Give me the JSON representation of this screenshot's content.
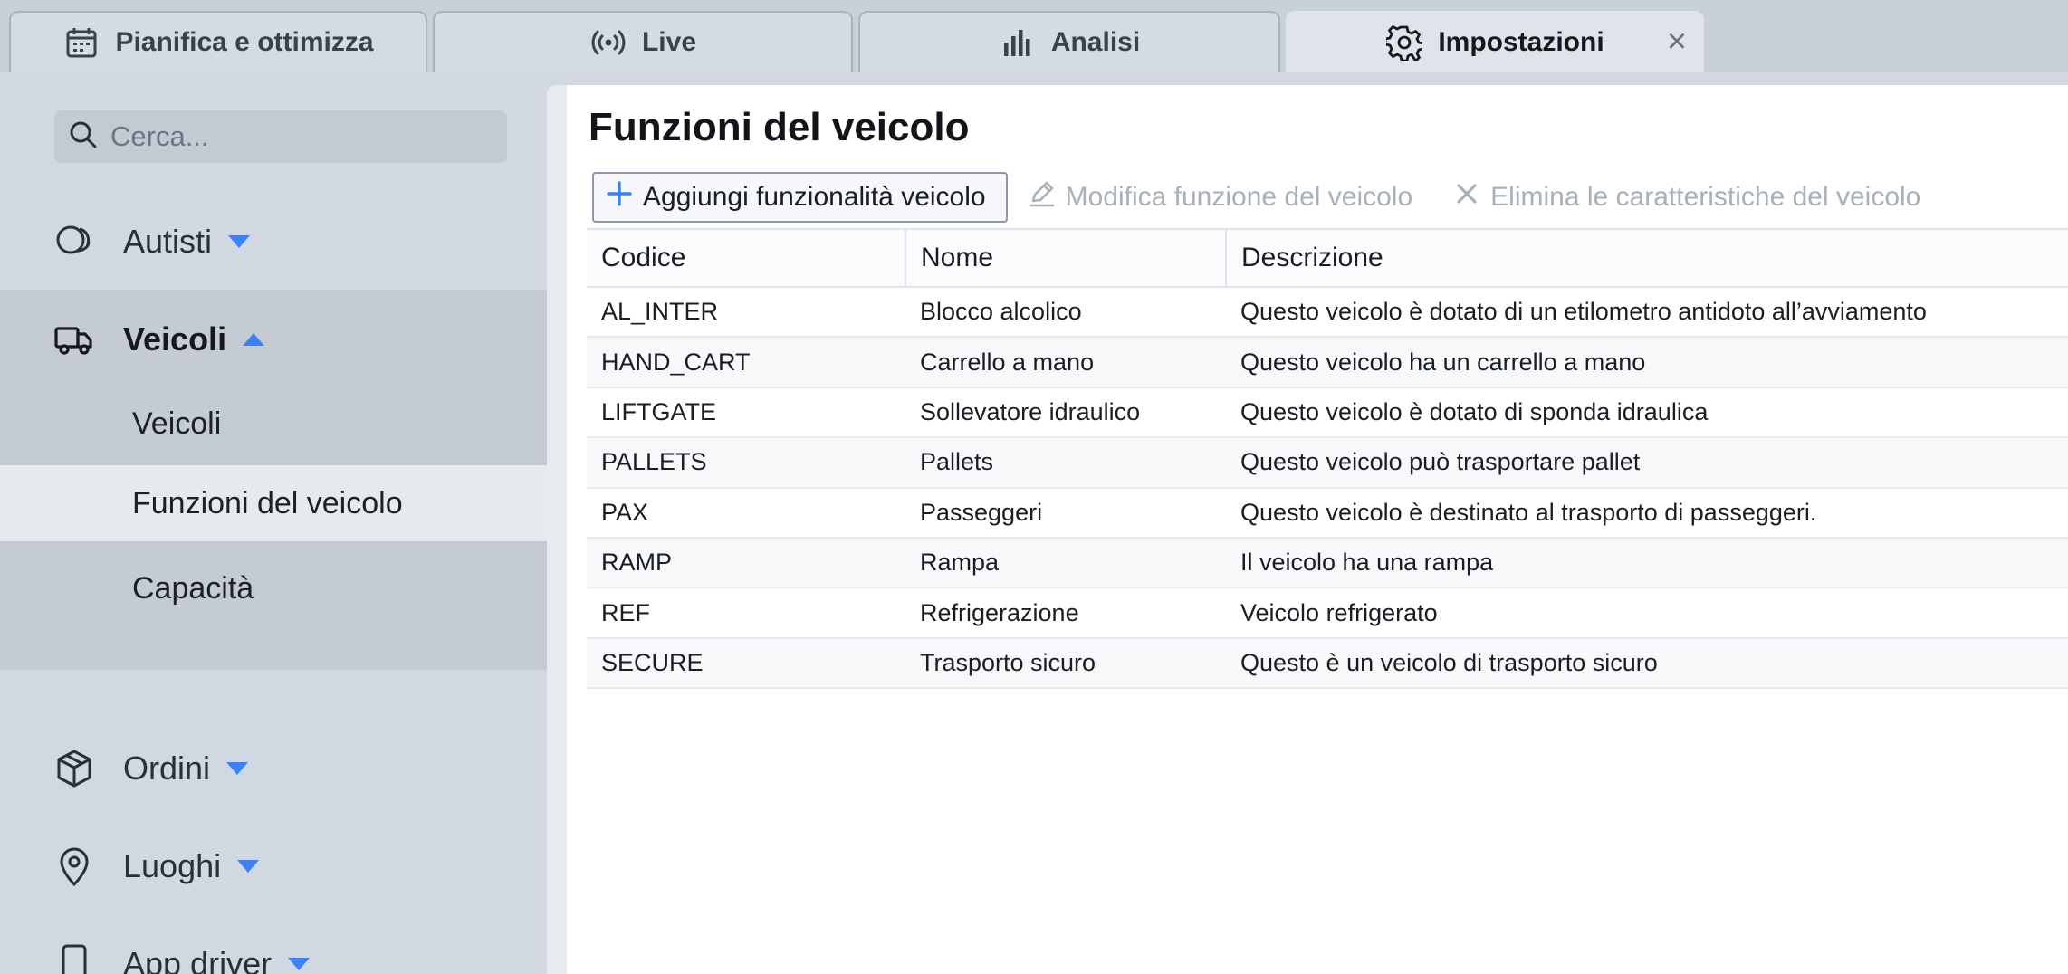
{
  "tabs": [
    {
      "label": "Pianifica e ottimizza",
      "icon": "calendar-icon"
    },
    {
      "label": "Live",
      "icon": "broadcast-icon"
    },
    {
      "label": "Analisi",
      "icon": "bar-chart-icon"
    },
    {
      "label": "Impostazioni",
      "icon": "gear-icon",
      "active": true,
      "close_label": "×"
    }
  ],
  "sidebar": {
    "search_placeholder": "Cerca...",
    "items": [
      {
        "label": "Autisti",
        "icon": "drivers-icon",
        "expanded": false
      },
      {
        "label": "Veicoli",
        "icon": "truck-icon",
        "expanded": true,
        "children": [
          {
            "label": "Veicoli"
          },
          {
            "label": "Funzioni del veicolo",
            "active": true
          },
          {
            "label": "Capacità"
          }
        ]
      },
      {
        "label": "Ordini",
        "icon": "package-icon",
        "expanded": false
      },
      {
        "label": "Luoghi",
        "icon": "map-pin-icon",
        "expanded": false
      },
      {
        "label": "App driver",
        "icon": "smartphone-icon",
        "expanded": false
      }
    ]
  },
  "main": {
    "title": "Funzioni del veicolo",
    "toolbar": {
      "add": "Aggiungi funzionalità veicolo",
      "edit": "Modifica funzione del veicolo",
      "delete": "Elimina le caratteristiche del veicolo"
    },
    "table": {
      "columns": [
        "Codice",
        "Nome",
        "Descrizione"
      ],
      "rows": [
        [
          "AL_INTER",
          "Blocco alcolico",
          "Questo veicolo è dotato di un etilometro antidoto all’avviamento"
        ],
        [
          "HAND_CART",
          "Carrello a mano",
          "Questo veicolo ha un carrello a mano"
        ],
        [
          "LIFTGATE",
          "Sollevatore idraulico",
          "Questo veicolo è dotato di sponda idraulica"
        ],
        [
          "PALLETS",
          "Pallets",
          "Questo veicolo può trasportare pallet"
        ],
        [
          "PAX",
          "Passeggeri",
          "Questo veicolo è destinato al trasporto di passeggeri."
        ],
        [
          "RAMP",
          "Rampa",
          "Il veicolo ha una rampa"
        ],
        [
          "REF",
          "Refrigerazione",
          "Veicolo refrigerato"
        ],
        [
          "SECURE",
          "Trasporto sicuro",
          "Questo è un veicolo di trasporto sicuro"
        ]
      ]
    }
  },
  "colors": {
    "accent": "#3b82f6",
    "sidebar_bg": "#d2d8e1",
    "disabled_text": "#a8b0ba"
  }
}
